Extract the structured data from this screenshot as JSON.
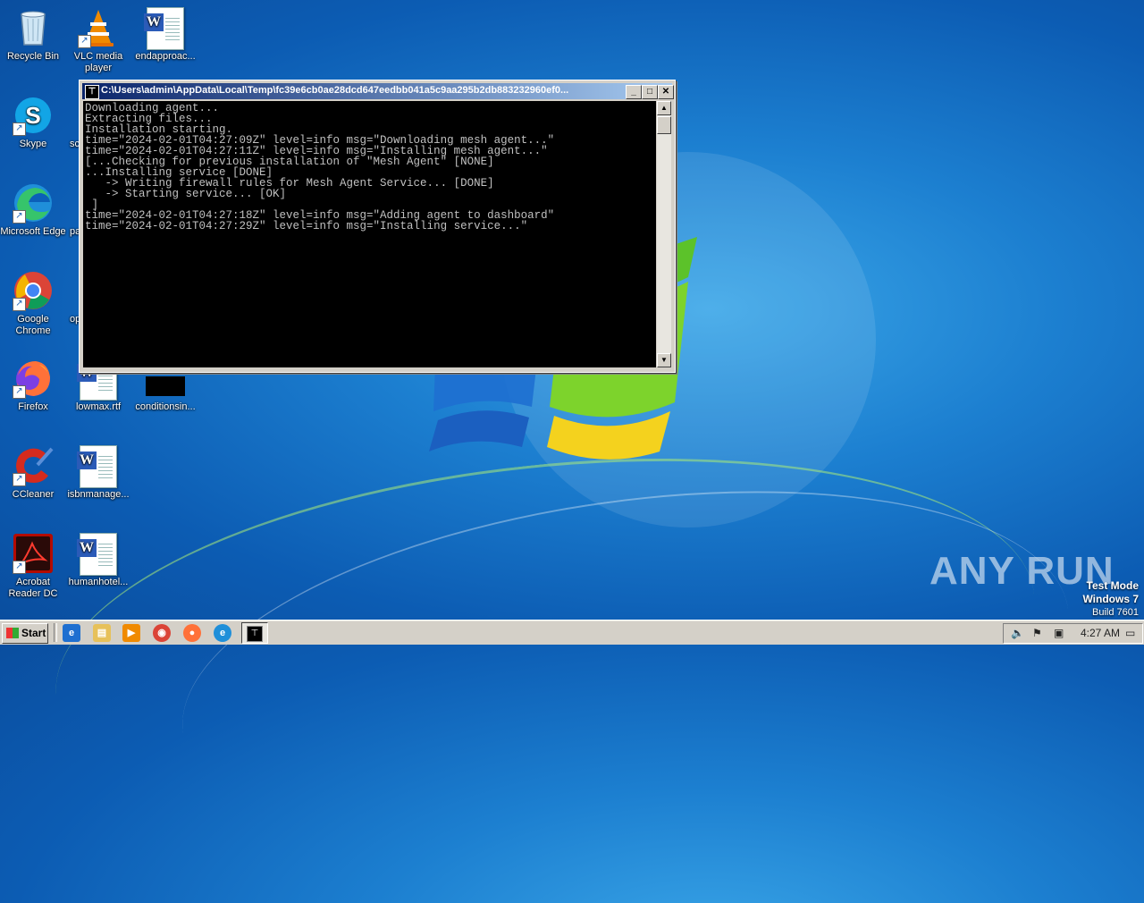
{
  "desktop": {
    "icons": [
      {
        "label": "Recycle Bin",
        "icon": "recycle-bin-icon"
      },
      {
        "label": "VLC media player",
        "icon": "vlc-icon"
      },
      {
        "label": "endapproac...",
        "icon": "word-document-icon"
      },
      {
        "label": "Skype",
        "icon": "skype-icon"
      },
      {
        "label": "sc",
        "icon": "partial-icon"
      },
      {
        "label": "Microsoft Edge",
        "icon": "edge-icon"
      },
      {
        "label": "pa",
        "icon": "partial-icon"
      },
      {
        "label": "Google Chrome",
        "icon": "chrome-icon"
      },
      {
        "label": "op",
        "icon": "partial-icon"
      },
      {
        "label": "Firefox",
        "icon": "firefox-icon"
      },
      {
        "label": "lowmax.rtf",
        "icon": "word-document-icon"
      },
      {
        "label": "conditionsin...",
        "icon": "black-file-icon"
      },
      {
        "label": "CCleaner",
        "icon": "ccleaner-icon"
      },
      {
        "label": "isbnmanage...",
        "icon": "word-document-icon"
      },
      {
        "label": "Acrobat Reader DC",
        "icon": "acrobat-icon"
      },
      {
        "label": "humanhotel...",
        "icon": "word-document-icon"
      }
    ]
  },
  "console_window": {
    "title": "C:\\Users\\admin\\AppData\\Local\\Temp\\fc39e6cb0ae28dcd647eedbb041a5c9aa295b2db883232960ef0...",
    "lines": [
      "Downloading agent...",
      "Extracting files...",
      "Installation starting.",
      "time=\"2024-02-01T04:27:09Z\" level=info msg=\"Downloading mesh agent...\"",
      "time=\"2024-02-01T04:27:11Z\" level=info msg=\"Installing mesh agent...\"",
      "[...Checking for previous installation of \"Mesh Agent\" [NONE]",
      "...Installing service [DONE]",
      "   -> Writing firewall rules for Mesh Agent Service... [DONE]",
      "   -> Starting service... [OK]",
      " ]",
      "time=\"2024-02-01T04:27:18Z\" level=info msg=\"Adding agent to dashboard\"",
      "time=\"2024-02-01T04:27:29Z\" level=info msg=\"Installing service...\""
    ]
  },
  "watermark": {
    "brand": "ANY RUN",
    "test_mode": "Test Mode",
    "os": "Windows 7",
    "build": "Build 7601"
  },
  "taskbar": {
    "start_label": "Start",
    "clock": "4:27 AM"
  }
}
